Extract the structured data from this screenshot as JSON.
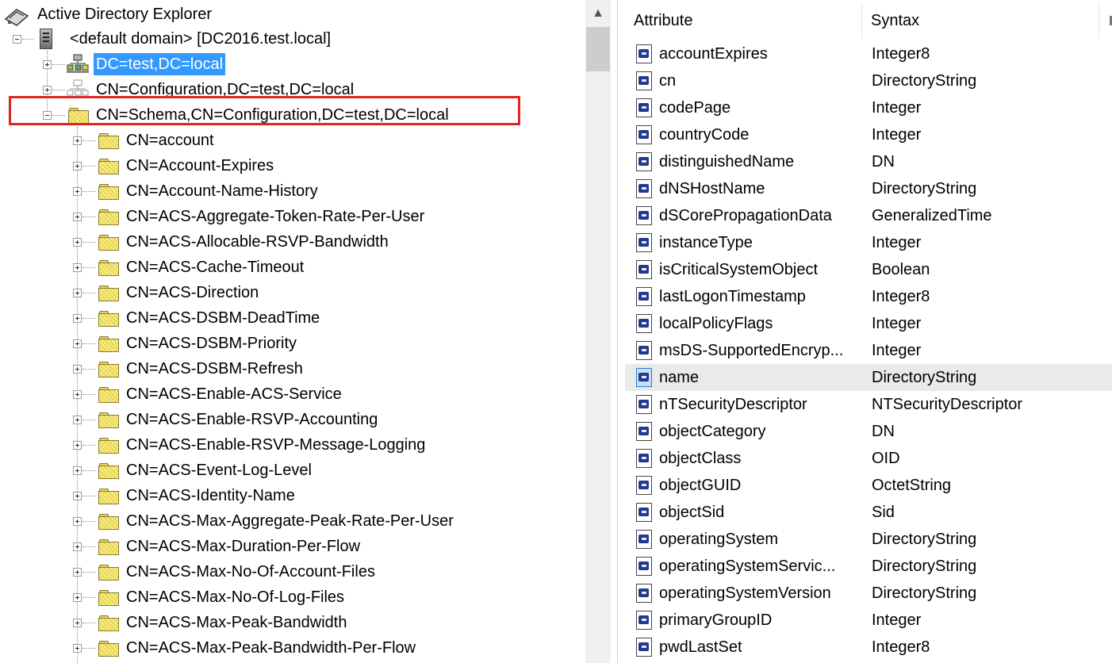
{
  "tree": {
    "root_label": "Active Directory Explorer",
    "domain_label": "<default domain> [DC2016.test.local]",
    "top_nodes": [
      {
        "label": "DC=test,DC=local",
        "selected": true
      },
      {
        "label": "CN=Configuration,DC=test,DC=local",
        "selected": false
      },
      {
        "label": "CN=Schema,CN=Configuration,DC=test,DC=local",
        "selected": false
      }
    ],
    "schema_children": [
      "CN=account",
      "CN=Account-Expires",
      "CN=Account-Name-History",
      "CN=ACS-Aggregate-Token-Rate-Per-User",
      "CN=ACS-Allocable-RSVP-Bandwidth",
      "CN=ACS-Cache-Timeout",
      "CN=ACS-Direction",
      "CN=ACS-DSBM-DeadTime",
      "CN=ACS-DSBM-Priority",
      "CN=ACS-DSBM-Refresh",
      "CN=ACS-Enable-ACS-Service",
      "CN=ACS-Enable-RSVP-Accounting",
      "CN=ACS-Enable-RSVP-Message-Logging",
      "CN=ACS-Event-Log-Level",
      "CN=ACS-Identity-Name",
      "CN=ACS-Max-Aggregate-Peak-Rate-Per-User",
      "CN=ACS-Max-Duration-Per-Flow",
      "CN=ACS-Max-No-Of-Account-Files",
      "CN=ACS-Max-No-Of-Log-Files",
      "CN=ACS-Max-Peak-Bandwidth",
      "CN=ACS-Max-Peak-Bandwidth-Per-Flow"
    ]
  },
  "list": {
    "columns": [
      "Attribute",
      "Syntax"
    ],
    "rows": [
      {
        "attribute": "accountExpires",
        "syntax": "Integer8"
      },
      {
        "attribute": "cn",
        "syntax": "DirectoryString"
      },
      {
        "attribute": "codePage",
        "syntax": "Integer"
      },
      {
        "attribute": "countryCode",
        "syntax": "Integer"
      },
      {
        "attribute": "distinguishedName",
        "syntax": "DN"
      },
      {
        "attribute": "dNSHostName",
        "syntax": "DirectoryString"
      },
      {
        "attribute": "dSCorePropagationData",
        "syntax": "GeneralizedTime"
      },
      {
        "attribute": "instanceType",
        "syntax": "Integer"
      },
      {
        "attribute": "isCriticalSystemObject",
        "syntax": "Boolean"
      },
      {
        "attribute": "lastLogonTimestamp",
        "syntax": "Integer8"
      },
      {
        "attribute": "localPolicyFlags",
        "syntax": "Integer"
      },
      {
        "attribute": "msDS-SupportedEncryp...",
        "syntax": "Integer"
      },
      {
        "attribute": "name",
        "syntax": "DirectoryString",
        "hover": true
      },
      {
        "attribute": "nTSecurityDescriptor",
        "syntax": "NTSecurityDescriptor"
      },
      {
        "attribute": "objectCategory",
        "syntax": "DN"
      },
      {
        "attribute": "objectClass",
        "syntax": "OID"
      },
      {
        "attribute": "objectGUID",
        "syntax": "OctetString"
      },
      {
        "attribute": "objectSid",
        "syntax": "Sid"
      },
      {
        "attribute": "operatingSystem",
        "syntax": "DirectoryString"
      },
      {
        "attribute": "operatingSystemServic...",
        "syntax": "DirectoryString"
      },
      {
        "attribute": "operatingSystemVersion",
        "syntax": "DirectoryString"
      },
      {
        "attribute": "primaryGroupID",
        "syntax": "Integer"
      },
      {
        "attribute": "pwdLastSet",
        "syntax": "Integer8"
      }
    ]
  },
  "colors": {
    "selection": "#3399ff",
    "highlight_box": "#e02424",
    "hover_row": "#eaeaea"
  }
}
